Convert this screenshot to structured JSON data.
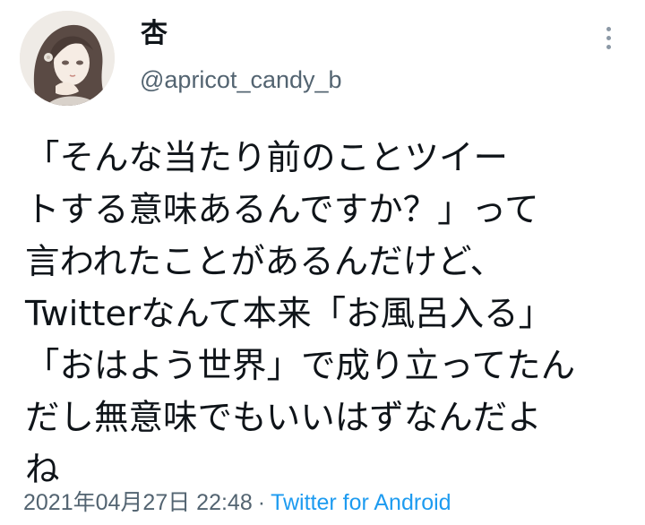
{
  "user": {
    "display_name": "杏",
    "handle": "@apricot_candy_b"
  },
  "tweet": {
    "lines": [
      "「そんな当たり前のことツイー",
      "トする意味あるんですか？」って",
      "言われたことがあるんだけど、",
      "Twitterなんて本来「お風呂入る」",
      "「おはよう世界」で成り立ってたん",
      "だし無意味でもいいはずなんだよ",
      "ね"
    ]
  },
  "meta": {
    "timestamp": "2021年04月27日 22:48",
    "separator": "·",
    "source": "Twitter for Android"
  },
  "icons": {
    "more": "more-vertical-icon",
    "avatar": "avatar-illustration"
  },
  "colors": {
    "text": "#0f1419",
    "secondary": "#536471",
    "link": "#1d9bf0"
  }
}
